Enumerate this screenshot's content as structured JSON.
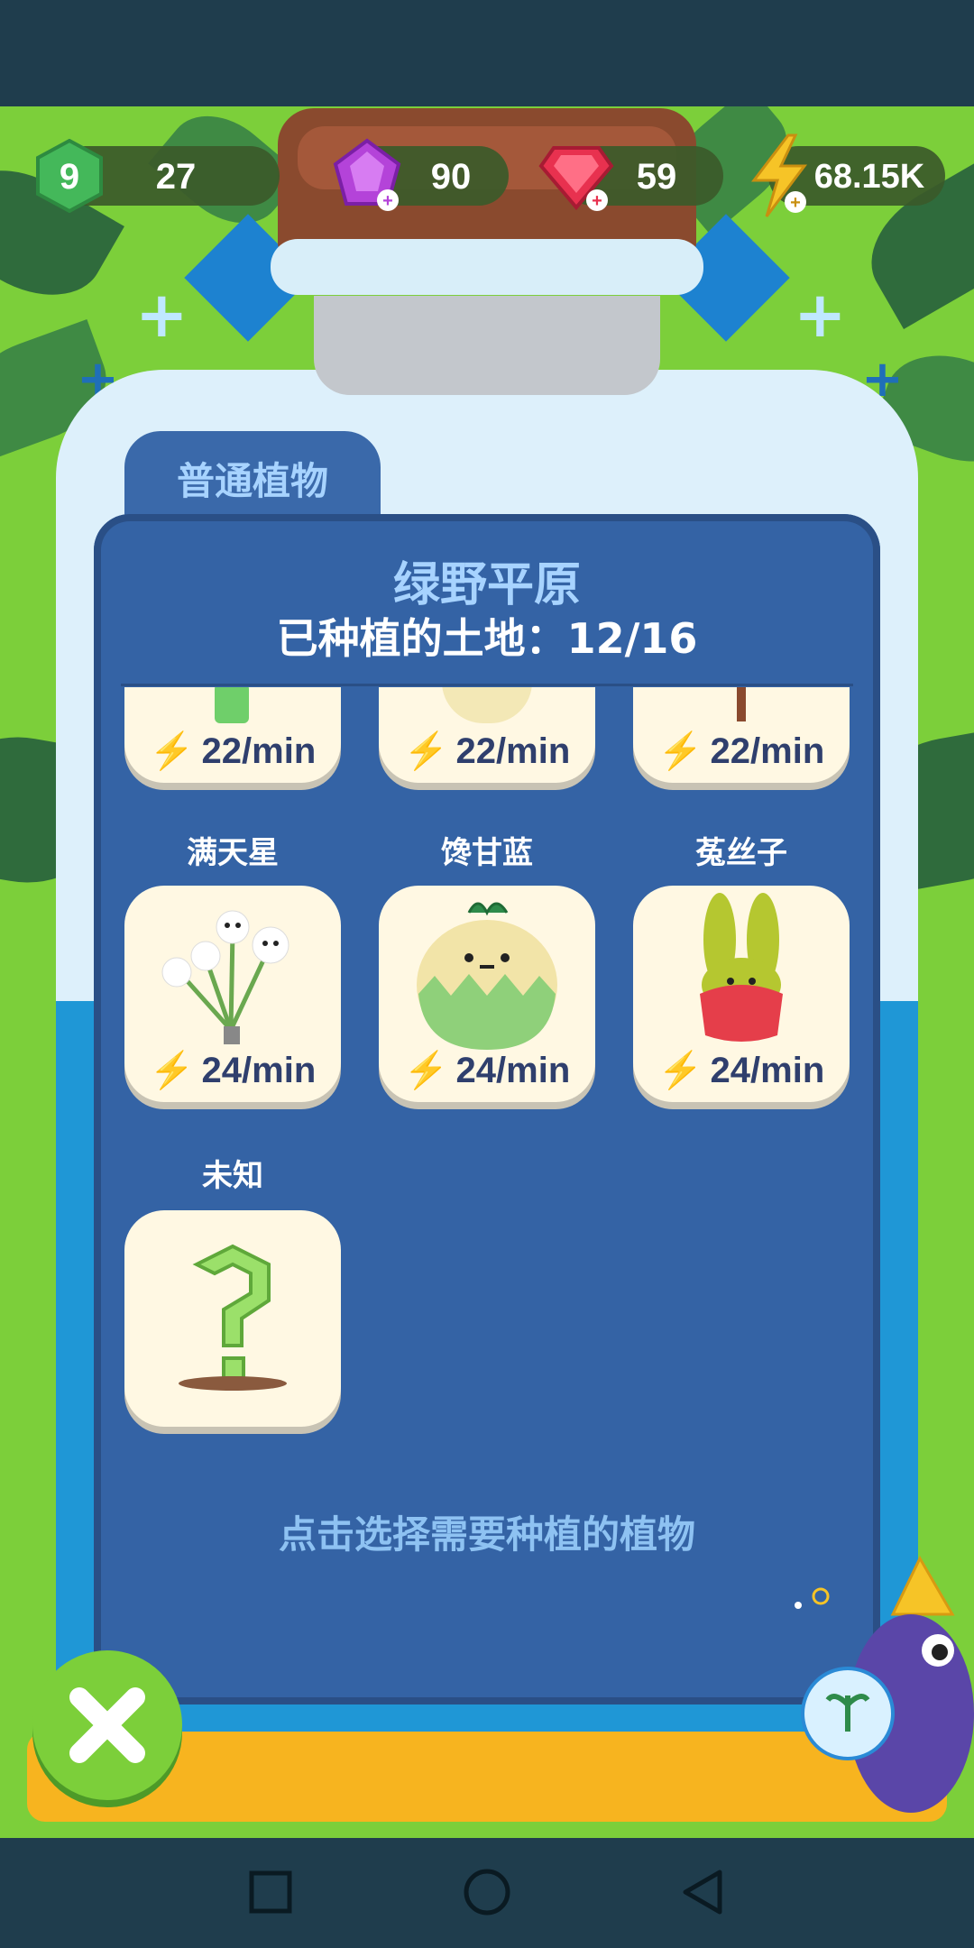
{
  "hud": {
    "level": "9",
    "level_progress": "27",
    "purple_gems": "90",
    "red_gems": "59",
    "energy": "68.15K"
  },
  "panel": {
    "tab_label": "普通植物",
    "title": "绿野平原",
    "planted_land": "已种植的土地：12/16",
    "hint": "点击选择需要种植的植物"
  },
  "top_row": [
    {
      "rate": "22/min"
    },
    {
      "rate": "22/min"
    },
    {
      "rate": "22/min"
    }
  ],
  "plants": [
    {
      "name": "满天星",
      "rate": "24/min"
    },
    {
      "name": "馋甘蓝",
      "rate": "24/min"
    },
    {
      "name": "菟丝子",
      "rate": "24/min"
    },
    {
      "name": "未知"
    }
  ],
  "icons": {
    "level": "hexagon-level-icon",
    "purple": "purple-gem-icon",
    "red": "red-gem-icon",
    "energy": "lightning-icon",
    "close": "close-icon",
    "nav": [
      "square-icon",
      "circle-icon",
      "back-triangle-icon"
    ]
  },
  "colors": {
    "panel": "#3463a5",
    "card": "#fff8e3",
    "accent_green": "#7ccf3a",
    "text_blue": "#a7d3ff"
  }
}
